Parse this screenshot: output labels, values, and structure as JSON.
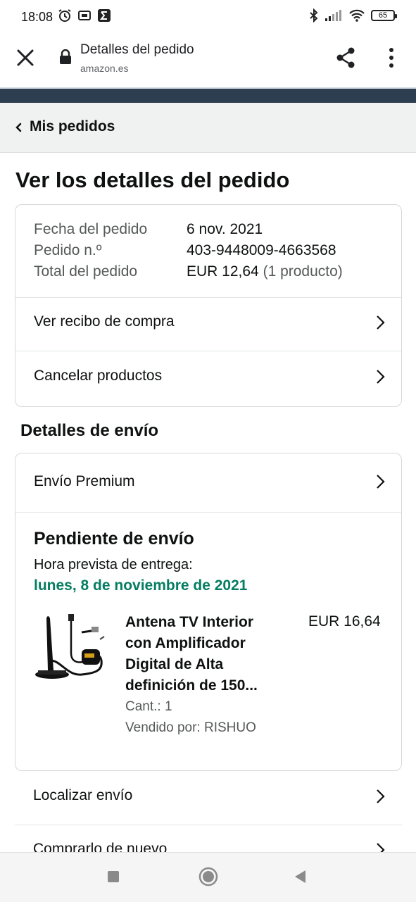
{
  "status_bar": {
    "time": "18:08",
    "battery": "65"
  },
  "browser": {
    "title": "Detalles del pedido",
    "url": "amazon.es"
  },
  "breadcrumb": {
    "label": "Mis pedidos"
  },
  "page": {
    "heading": "Ver los detalles del pedido"
  },
  "order": {
    "date_label": "Fecha del pedido",
    "date_value": "6 nov. 2021",
    "number_label": "Pedido n.º",
    "number_value": "403-9448009-4663568",
    "total_label": "Total del pedido",
    "total_value": "EUR 12,64",
    "total_count": "(1 producto)",
    "actions": [
      {
        "label": "Ver recibo de compra"
      },
      {
        "label": "Cancelar productos"
      }
    ]
  },
  "shipping": {
    "heading": "Detalles de envío",
    "method": "Envío Premium",
    "status": "Pendiente de envío",
    "eta_label": "Hora prevista de entrega:",
    "eta_date": "lunes, 8 de noviembre de 2021",
    "product": {
      "title": "Antena TV Interior con Amplificador Digital de Alta definición de 150...",
      "price": "EUR 16,64",
      "quantity": "Cant.: 1",
      "seller": "Vendido por: RISHUO"
    }
  },
  "more_actions": [
    {
      "label": "Localizar envío"
    },
    {
      "label": "Comprarlo de nuevo"
    }
  ],
  "colors": {
    "delivery_green": "#067d62",
    "navy_band": "#2c3e50",
    "breadcrumb_bg": "#f0f2f2"
  }
}
